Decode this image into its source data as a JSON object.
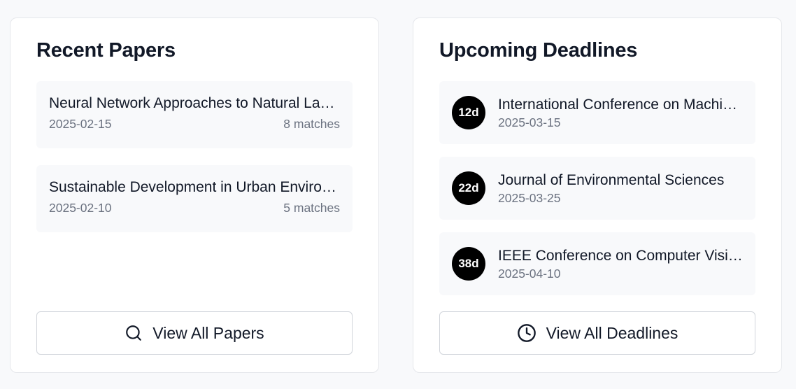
{
  "recent_papers": {
    "title": "Recent Papers",
    "items": [
      {
        "title": "Neural Network Approaches to Natural Language Processing",
        "date": "2025-02-15",
        "matches": "8 matches"
      },
      {
        "title": "Sustainable Development in Urban Environments",
        "date": "2025-02-10",
        "matches": "5 matches"
      }
    ],
    "button_label": "View All Papers",
    "button_icon": "search-icon"
  },
  "upcoming_deadlines": {
    "title": "Upcoming Deadlines",
    "items": [
      {
        "days": "12d",
        "title": "International Conference on Machine Learning",
        "date": "2025-03-15"
      },
      {
        "days": "22d",
        "title": "Journal of Environmental Sciences",
        "date": "2025-03-25"
      },
      {
        "days": "38d",
        "title": "IEEE Conference on Computer Vision",
        "date": "2025-04-10"
      }
    ],
    "button_label": "View All Deadlines",
    "button_icon": "clock-icon"
  },
  "colors": {
    "page_bg": "#f8f9fb",
    "card_bg": "#ffffff",
    "item_bg": "#f8f9fb",
    "badge_bg": "#000000",
    "text_primary": "#111827",
    "text_muted": "#6b7280"
  }
}
